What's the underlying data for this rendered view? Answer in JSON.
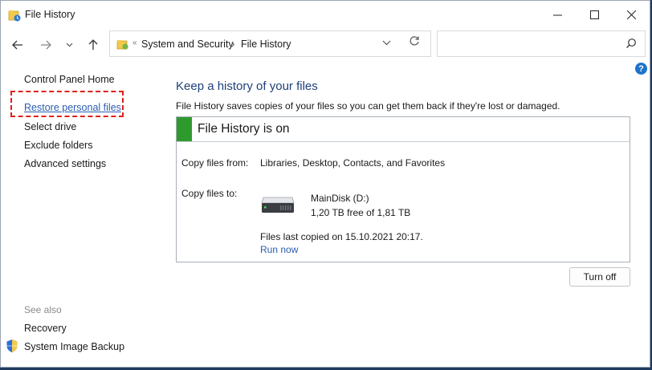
{
  "window": {
    "title": "File History",
    "minimize_icon": "minimize-icon",
    "maximize_icon": "maximize-icon",
    "close_icon": "close-icon"
  },
  "address": {
    "back_icon": "back-arrow-icon",
    "forward_icon": "forward-arrow-icon",
    "recent_icon": "chevron-down-icon",
    "up_icon": "up-arrow-icon",
    "breadcrumbs": [
      "System and Security",
      "File History"
    ],
    "search_placeholder": ""
  },
  "sidebar": {
    "items": [
      {
        "label": "Control Panel Home"
      },
      {
        "label": "Restore personal files"
      },
      {
        "label": "Select drive"
      },
      {
        "label": "Exclude folders"
      },
      {
        "label": "Advanced settings"
      }
    ],
    "see_also_label": "See also",
    "see_also": [
      {
        "label": "Recovery"
      },
      {
        "label": "System Image Backup"
      }
    ]
  },
  "main": {
    "title": "Keep a history of your files",
    "description": "File History saves copies of your files so you can get them back if they're lost or damaged.",
    "status": "File History is on",
    "status_color": "#2e9a2e",
    "copy_from_label": "Copy files from:",
    "copy_from_value": "Libraries, Desktop, Contacts, and Favorites",
    "copy_to_label": "Copy files to:",
    "drive_name": "MainDisk (D:)",
    "drive_free": "1,20 TB free of 1,81 TB",
    "last_copied": "Files last copied on 15.10.2021 20:17.",
    "run_now": "Run now",
    "turn_off": "Turn off"
  },
  "colors": {
    "link": "#2a5db0",
    "heading": "#1e3f7a",
    "highlight": "#e0201b"
  }
}
